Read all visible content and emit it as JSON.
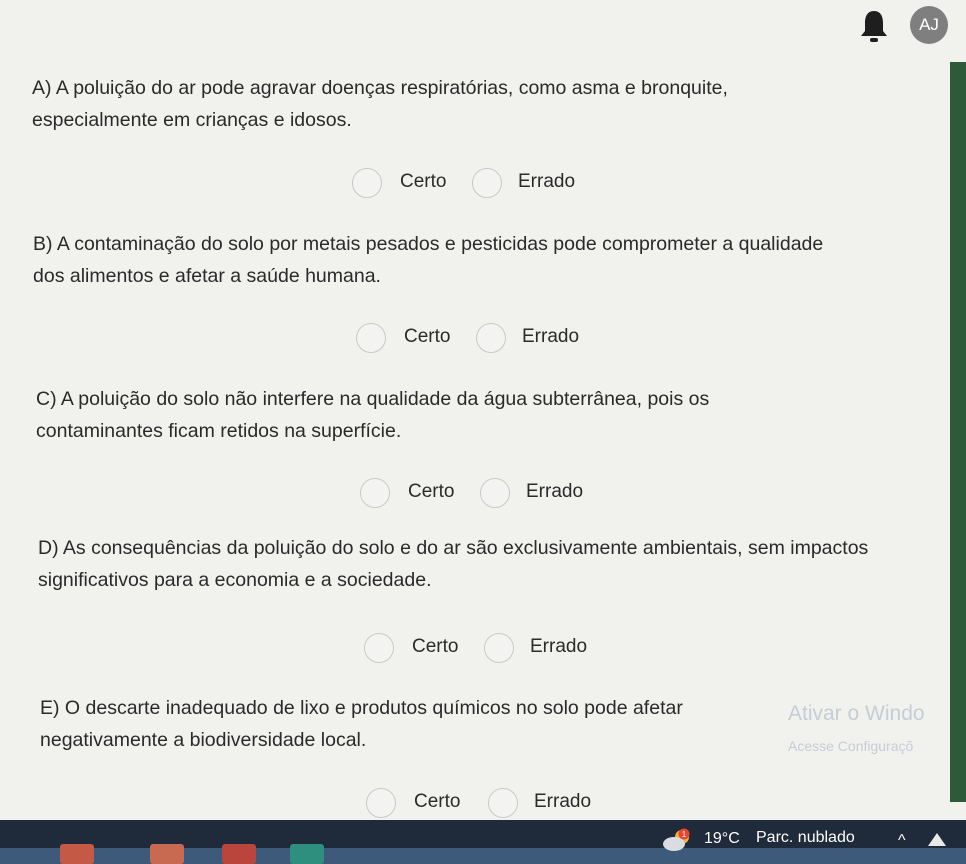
{
  "header": {
    "avatar_initials": "AJ",
    "notification_icon": "bell-icon"
  },
  "questions": [
    {
      "text": "A) A poluição do ar pode agravar doenças respiratórias, como asma e bronquite, especialmente em crianças e idosos.",
      "option_true": "Certo",
      "option_false": "Errado"
    },
    {
      "text": "B) A contaminação do solo por metais pesados e pesticidas pode comprometer a qualidade dos alimentos e afetar a saúde humana.",
      "option_true": "Certo",
      "option_false": "Errado"
    },
    {
      "text": "C) A poluição do solo não interfere na qualidade da água subterrânea, pois os contaminantes ficam retidos na superfície.",
      "option_true": "Certo",
      "option_false": "Errado"
    },
    {
      "text": "D) As consequências da poluição do solo e do ar são exclusivamente ambientais, sem impactos significativos para a economia e a sociedade.",
      "option_true": "Certo",
      "option_false": "Errado"
    },
    {
      "text": "E) O descarte inadequado de lixo e produtos químicos no solo pode afetar negativamente a biodiversidade local.",
      "option_true": "Certo",
      "option_false": "Errado"
    }
  ],
  "watermark": {
    "title": "Ativar o Windo",
    "subtitle": "Acesse Configuraçõ"
  },
  "taskbar": {
    "temperature": "19°C",
    "weather": "Parc. nublado",
    "weather_icon": "partly-cloudy-icon",
    "weather_badge": "1",
    "colors": {
      "bar": "#1f2a3a",
      "accent": "#3d5a7a"
    }
  }
}
